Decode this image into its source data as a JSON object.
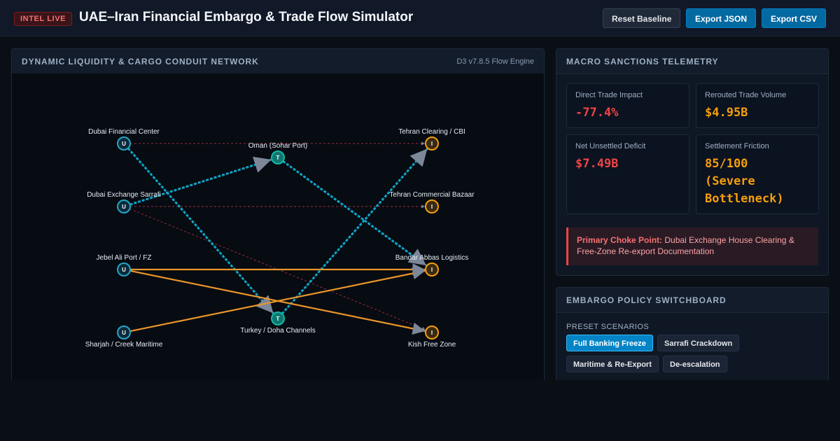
{
  "header": {
    "badge": "INTEL LIVE",
    "title": "UAE–Iran Financial Embargo & Trade Flow Simulator",
    "buttons": {
      "reset": "Reset Baseline",
      "export_json": "Export JSON",
      "export_csv": "Export CSV"
    }
  },
  "network": {
    "title": "DYNAMIC LIQUIDITY & CARGO CONDUIT NETWORK",
    "engine": "D3 v7.8.5 Flow Engine",
    "nodes": [
      {
        "id": "dfc",
        "label": "Dubai Financial Center",
        "type": "U"
      },
      {
        "id": "des",
        "label": "Dubai Exchange Sarrafi",
        "type": "U"
      },
      {
        "id": "jap",
        "label": "Jebel Ali Port / FZ",
        "type": "U"
      },
      {
        "id": "scm",
        "label": "Sharjah / Creek Maritime",
        "type": "U"
      },
      {
        "id": "osp",
        "label": "Oman (Sohar Port)",
        "type": "T"
      },
      {
        "id": "tdc",
        "label": "Turkey / Doha Channels",
        "type": "T"
      },
      {
        "id": "tcc",
        "label": "Tehran Clearing / CBI",
        "type": "I"
      },
      {
        "id": "tcb",
        "label": "Tehran Commercial Bazaar",
        "type": "I"
      },
      {
        "id": "bal",
        "label": "Bandar Abbas Logistics",
        "type": "I"
      },
      {
        "id": "kfz",
        "label": "Kish Free Zone",
        "type": "I"
      }
    ],
    "links": [
      {
        "source": "dfc",
        "target": "tcc",
        "kind": "blocked"
      },
      {
        "source": "des",
        "target": "tcb",
        "kind": "blocked"
      },
      {
        "source": "des",
        "target": "kfz",
        "kind": "blocked"
      },
      {
        "source": "dfc",
        "target": "tdc",
        "kind": "financial"
      },
      {
        "source": "des",
        "target": "osp",
        "kind": "financial"
      },
      {
        "source": "osp",
        "target": "bal",
        "kind": "financial"
      },
      {
        "source": "tdc",
        "target": "tcc",
        "kind": "financial"
      },
      {
        "source": "jap",
        "target": "bal",
        "kind": "cargo"
      },
      {
        "source": "jap",
        "target": "kfz",
        "kind": "cargo"
      },
      {
        "source": "scm",
        "target": "bal",
        "kind": "cargo"
      }
    ],
    "colors": {
      "uae": "#22a6c7",
      "transit": "#14b8a6",
      "iran": "#f59e0b",
      "financial": "#0ea5c6",
      "cargo": "#e8962a",
      "blocked": "#9b2c3a"
    }
  },
  "telemetry": {
    "title": "MACRO SANCTIONS TELEMETRY",
    "cards": [
      {
        "label": "Direct Trade Impact",
        "value": "-77.4%"
      },
      {
        "label": "Rerouted Trade Volume",
        "value": "$4.95B"
      },
      {
        "label": "Net Unsettled Deficit",
        "value": "$7.49B"
      },
      {
        "label": "Settlement Friction",
        "value": "85/100 (Severe Bottleneck)"
      }
    ],
    "choke_label": "Primary Choke Point:",
    "choke_text": "Dubai Exchange House Clearing & Free-Zone Re-export Documentation"
  },
  "switchboard": {
    "title": "EMBARGO POLICY SWITCHBOARD",
    "preset_label": "PRESET SCENARIOS",
    "presets": [
      "Full Banking Freeze",
      "Sarrafi Crackdown",
      "Maritime & Re-Export",
      "De-escalation"
    ],
    "active_preset": "Full Banking Freeze"
  }
}
